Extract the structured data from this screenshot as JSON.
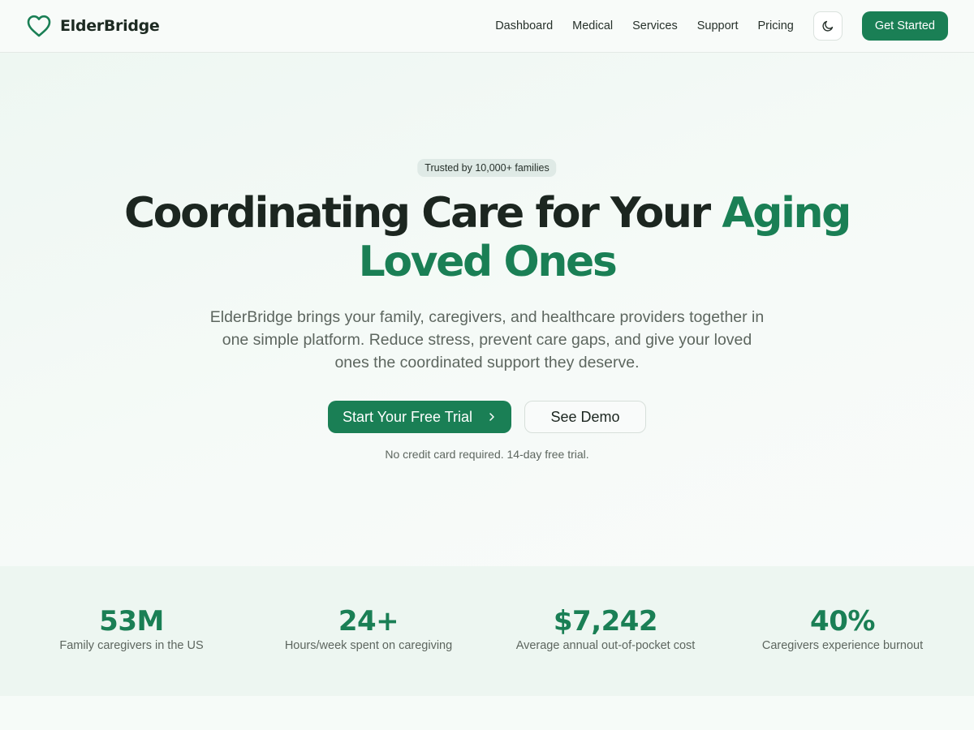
{
  "brand": {
    "name": "ElderBridge",
    "icon": "heart-icon"
  },
  "nav": {
    "links": [
      "Dashboard",
      "Medical",
      "Services",
      "Support",
      "Pricing"
    ],
    "theme_toggle_icon": "moon-icon",
    "cta_label": "Get Started"
  },
  "hero": {
    "badge": "Trusted by 10,000+ families",
    "headline_part1": "Coordinating Care for Your ",
    "headline_accent_line1": "Aging",
    "headline_accent_line2": "Loved Ones",
    "subtitle": "ElderBridge brings your family, caregivers, and healthcare providers together in one simple platform. Reduce stress, prevent care gaps, and give your loved ones the coordinated support they deserve.",
    "primary_button": "Start Your Free Trial",
    "primary_button_icon": "chevron-right-icon",
    "secondary_button": "See Demo",
    "note": "No credit card required. 14-day free trial."
  },
  "stats": [
    {
      "value": "53M",
      "label": "Family caregivers in the US"
    },
    {
      "value": "24+",
      "label": "Hours/week spent on caregiving"
    },
    {
      "value": "$7,242",
      "label": "Average annual out-of-pocket cost"
    },
    {
      "value": "40%",
      "label": "Caregivers experience burnout"
    }
  ],
  "colors": {
    "accent": "#1a7f55",
    "text": "#1c2620",
    "muted": "#5d665f",
    "badge_bg": "#dfeae6",
    "stats_bg": "#edf6f1"
  }
}
